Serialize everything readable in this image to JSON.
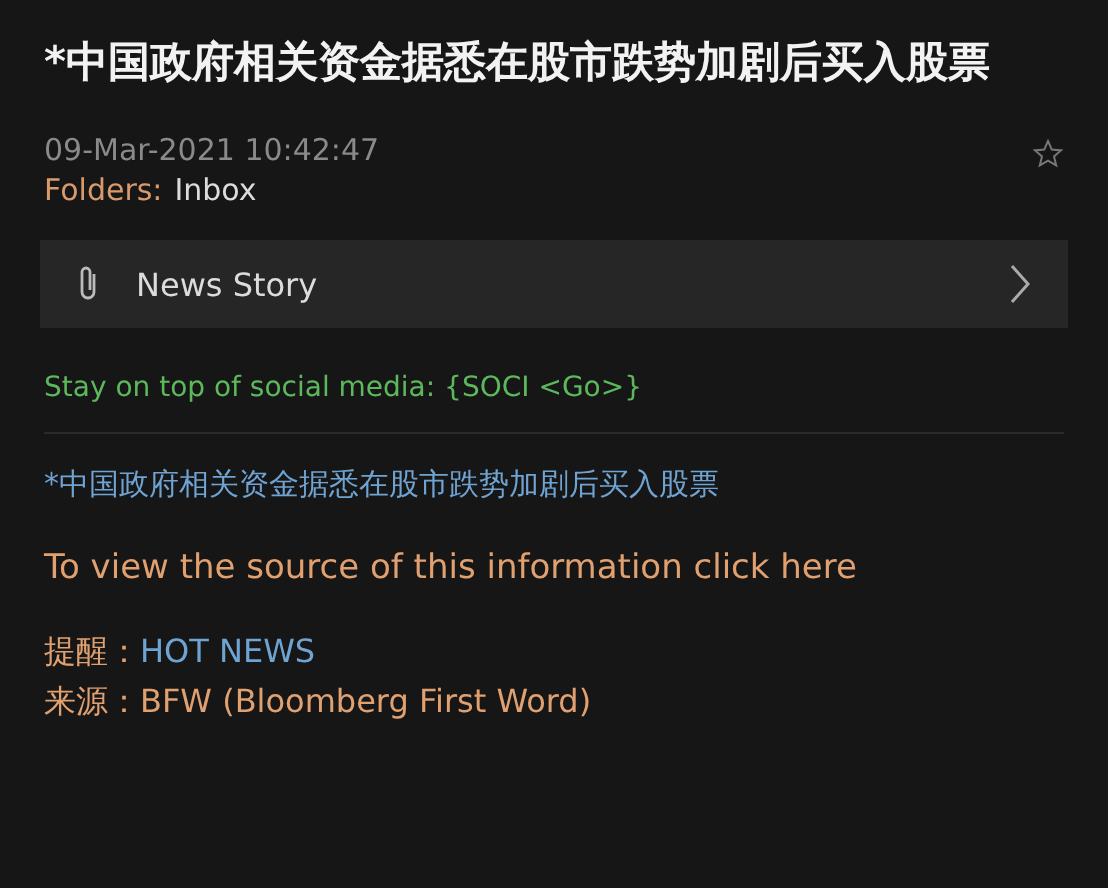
{
  "message": {
    "title": "*中国政府相关资金据悉在股市跌势加剧后买入股票",
    "timestamp": "09-Mar-2021 10:42:47",
    "folders": {
      "label": "Folders:",
      "value": "Inbox"
    }
  },
  "attachment": {
    "label": "News Story"
  },
  "promo": "Stay on top of social media: {SOCI <Go>}",
  "body": {
    "headline": "*中国政府相关资金据悉在股市跌势加剧后买入股票",
    "source_link": "To view the source of this information click here",
    "fields": [
      {
        "label": "提醒：",
        "value": "HOT NEWS",
        "kind": "alert"
      },
      {
        "label": "来源：",
        "value": "BFW (Bloomberg First Word)",
        "kind": "source"
      }
    ]
  }
}
